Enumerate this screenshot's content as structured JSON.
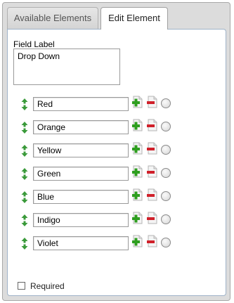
{
  "tabs": {
    "available_label": "Available Elements",
    "edit_label": "Edit Element"
  },
  "field": {
    "caption": "Field Label",
    "value": "Drop Down"
  },
  "options": [
    {
      "value": "Red"
    },
    {
      "value": "Orange"
    },
    {
      "value": "Yellow"
    },
    {
      "value": "Green"
    },
    {
      "value": "Blue"
    },
    {
      "value": "Indigo"
    },
    {
      "value": "Violet"
    }
  ],
  "required": {
    "label": "Required",
    "checked": false
  },
  "icons": {
    "move": "up-down-arrow-icon",
    "add": "add-document-icon",
    "remove": "remove-document-icon",
    "default": "radio-icon"
  },
  "colors": {
    "add_green": "#2e9e1f",
    "remove_red": "#d0202a",
    "arrow_green": "#3a9a3a",
    "panel_border": "#9fb3c8"
  }
}
